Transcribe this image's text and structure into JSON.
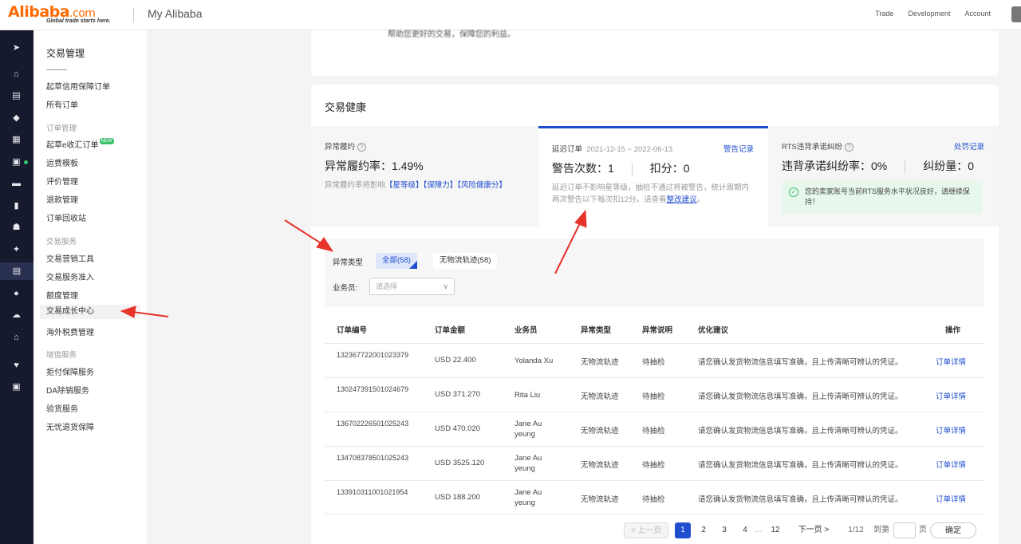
{
  "header": {
    "logo_text": "Alibaba",
    "logo_dotcom": ".com",
    "logo_tagline": "Global trade starts here.",
    "title": "My Alibaba",
    "nav": [
      "Trade",
      "Development",
      "Account"
    ]
  },
  "rail_icons": [
    "send-icon",
    "home-icon",
    "store-icon",
    "shield-icon",
    "grid-icon",
    "shop-icon",
    "message-icon",
    "chart-icon",
    "users-icon",
    "sparkle-icon",
    "order-icon",
    "circle-icon",
    "cloud-icon",
    "bank-icon",
    "heart-icon",
    "briefcase-icon"
  ],
  "sidebar": {
    "title": "交易管理",
    "items_top": [
      "起草信用保障订单",
      "所有订单"
    ],
    "group1": "订单管理",
    "items_g1": [
      "起草e收汇订单",
      "运费模板",
      "评价管理",
      "退款管理",
      "订单回收站"
    ],
    "new_badge": "NEW",
    "group2": "交易服务",
    "items_g2": [
      "交易营销工具",
      "交易服务准入",
      "额度管理",
      "交易成长中心",
      "海外税费管理"
    ],
    "group3": "增值服务",
    "items_g3": [
      "拒付保障服务",
      "DA除销服务",
      "验货服务",
      "无忧退货保障"
    ]
  },
  "top_card": {
    "text": "帮助您更好的交易，保障您的利益。"
  },
  "health": {
    "title": "交易健康",
    "panel1": {
      "label": "异常履约",
      "big": "异常履约率：1.49%",
      "desc_pre": "异常履约率将影响",
      "links": "【星等级】【保障力】【风险健康分】"
    },
    "panel2": {
      "label": "延迟订单",
      "date": "2021-12-15 ~ 2022-06-13",
      "link": "警告记录",
      "warn_label": "警告次数：1",
      "deduct_label": "扣分：0",
      "desc": "延迟订单不影响星等级，抽检不通过将被警告，统计周期内两次警告以下每次扣12分。请查看",
      "desc_link": "整改建议"
    },
    "panel3": {
      "label": "RTS违背承诺纠纷",
      "link": "处罚记录",
      "rate_label": "违背承诺纠纷率：0%",
      "count_label": "纠纷量：0",
      "ok_text": "您的卖家账号当前RTS服务水平状况良好，请继续保持！"
    }
  },
  "filters": {
    "type_label": "异常类型",
    "chips": [
      "全部(58)",
      "无物流轨迹(58)"
    ],
    "sales_label": "业务员:",
    "sales_placeholder": "请选择"
  },
  "table": {
    "headers": [
      "订单编号",
      "订单金额",
      "业务员",
      "异常类型",
      "异常说明",
      "优化建议",
      "操作"
    ],
    "rows": [
      {
        "order": "132367722001023379",
        "amount": "USD 22.400",
        "sales": "Yolanda Xu",
        "etype": "无物流轨迹",
        "edesc": "待抽检",
        "opt": "请您确认发货物流信息填写准确，且上传清晰可辨认的凭证。",
        "act": "订单详情"
      },
      {
        "order": "130247391501024679",
        "amount": "USD 371.270",
        "sales": "Rita Liu",
        "etype": "无物流轨迹",
        "edesc": "待抽检",
        "opt": "请您确认发货物流信息填写准确，且上传清晰可辨认的凭证。",
        "act": "订单详情"
      },
      {
        "order": "136702226501025243",
        "amount": "USD 470.020",
        "sales": "Jane Au yeung",
        "etype": "无物流轨迹",
        "edesc": "待抽检",
        "opt": "请您确认发货物流信息填写准确，且上传清晰可辨认的凭证。",
        "act": "订单详情"
      },
      {
        "order": "134708378501025243",
        "amount": "USD 3525.120",
        "sales": "Jane Au yeung",
        "etype": "无物流轨迹",
        "edesc": "待抽检",
        "opt": "请您确认发货物流信息填写准确，且上传清晰可辨认的凭证。",
        "act": "订单详情"
      },
      {
        "order": "133910311001021954",
        "amount": "USD 188.200",
        "sales": "Jane Au yeung",
        "etype": "无物流轨迹",
        "edesc": "待抽检",
        "opt": "请您确认发货物流信息填写准确，且上传清晰可辨认的凭证。",
        "act": "订单详情"
      }
    ]
  },
  "pagination": {
    "prev": "< 上一页",
    "pages": [
      "1",
      "2",
      "3",
      "4",
      "...",
      "12"
    ],
    "next": "下一页 >",
    "info": "1/12",
    "goto": "到第",
    "page_unit": "页",
    "confirm": "确定"
  },
  "colors": {
    "accent": "#1f4ecf",
    "brand": "#ff6a00",
    "rail_bg": "#151a2e",
    "annotation_arrow": "#e8332a"
  }
}
